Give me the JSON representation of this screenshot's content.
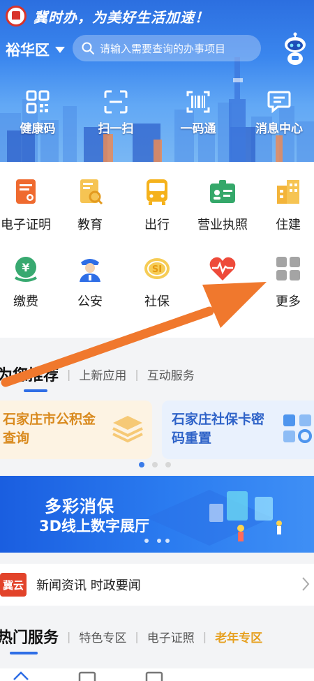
{
  "header": {
    "slogan": "冀时办，为美好生活加速！",
    "district": "裕华区",
    "search_placeholder": "请输入需要查询的办事项目"
  },
  "quick_actions": [
    {
      "label": "健康码",
      "icon": "qr-grid-icon"
    },
    {
      "label": "扫一扫",
      "icon": "scan-icon"
    },
    {
      "label": "一码通",
      "icon": "barcode-icon"
    },
    {
      "label": "消息中心",
      "icon": "message-icon"
    }
  ],
  "services": {
    "row1": [
      {
        "label": "电子证明",
        "icon": "certificate-icon",
        "color": "#ef6a2f"
      },
      {
        "label": "教育",
        "icon": "education-icon",
        "color": "#f2b33a"
      },
      {
        "label": "出行",
        "icon": "bus-icon",
        "color": "#f5b21c"
      },
      {
        "label": "营业执照",
        "icon": "license-icon",
        "color": "#35a86a"
      },
      {
        "label": "住建",
        "icon": "building-icon",
        "color": "#f3b43a"
      }
    ],
    "row2": [
      {
        "label": "缴费",
        "icon": "payment-icon",
        "color": "#38a970"
      },
      {
        "label": "公安",
        "icon": "police-icon",
        "color": "#2f6ee6"
      },
      {
        "label": "社保",
        "icon": "social-security-icon",
        "color": "#f2b42c"
      },
      {
        "label": "医",
        "icon": "heart-pulse-icon",
        "color": "#ee4a3a"
      },
      {
        "label": "更多",
        "icon": "more-grid-icon",
        "color": "#9a9a9a"
      }
    ]
  },
  "recommend": {
    "active_tab": "为您推荐",
    "tabs": [
      "上新应用",
      "互动服务"
    ],
    "cards": [
      {
        "title": "石家庄市公积金查询",
        "icon": "layers-icon"
      },
      {
        "title": "石家庄社保卡密码重置",
        "icon": "settings-grid-icon"
      }
    ]
  },
  "banner": {
    "title": "多彩消保",
    "subtitle": "3D线上数字展厅"
  },
  "news": {
    "logo_text": "冀云",
    "text": "新闻资讯 时政要闻"
  },
  "hot": {
    "active_tab": "热门服务",
    "tabs": [
      "特色专区",
      "电子证照"
    ],
    "highlight_tab": "老年专区"
  },
  "colors": {
    "primary": "#2f6ee6",
    "arrow": "#f0782d"
  }
}
